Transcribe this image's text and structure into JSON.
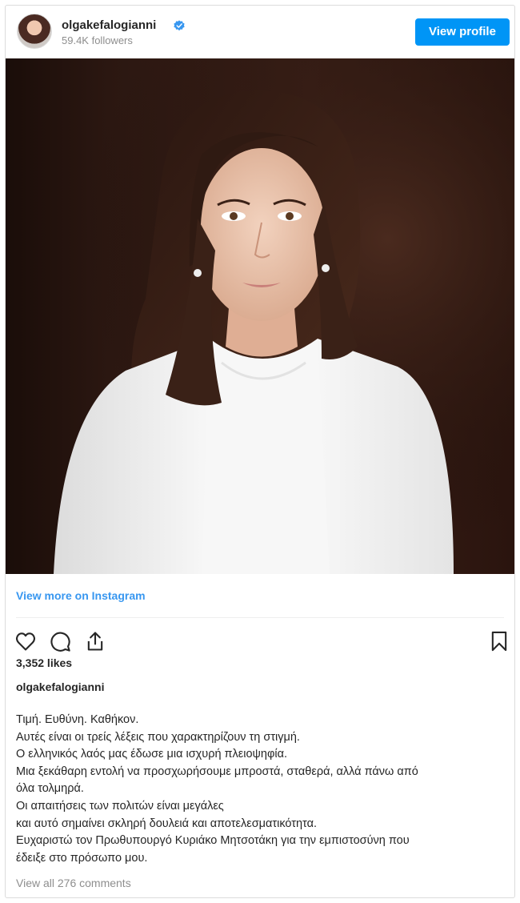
{
  "header": {
    "username": "olgakefalogianni",
    "followers": "59.4K followers",
    "view_profile_label": "View profile"
  },
  "post": {
    "view_more_label": "View more on Instagram",
    "likes": "3,352 likes",
    "caption_user": "olgakefalogianni",
    "caption_lines": [
      "Τιμή. Ευθύνη. Καθήκον.",
      "Αυτές είναι οι τρείς λέξεις που χαρακτηρίζουν τη στιγμή.",
      "Ο ελληνικός λαός μας έδωσε μια ισχυρή πλειοψηφία.",
      "Μια ξεκάθαρη εντολή να προσχωρήσουμε μπροστά, σταθερά, αλλά πάνω από",
      "όλα τολμηρά.",
      "Οι απαιτήσεις των πολιτών είναι μεγάλες",
      "και αυτό σημαίνει σκληρή δουλειά και αποτελεσματικότητα.",
      "Ευχαριστώ τον Πρωθυπουργό Κυριάκο Μητσοτάκη για την εμπιστοσύνη που",
      "έδειξε στο πρόσωπο μου."
    ],
    "comments_label": "View all 276 comments"
  },
  "icons": [
    "heart-icon",
    "comment-icon",
    "share-icon",
    "bookmark-icon",
    "verified-badge-icon"
  ],
  "colors": {
    "accent": "#0095f6",
    "link": "#3897f0",
    "muted": "#8e8e8e"
  }
}
